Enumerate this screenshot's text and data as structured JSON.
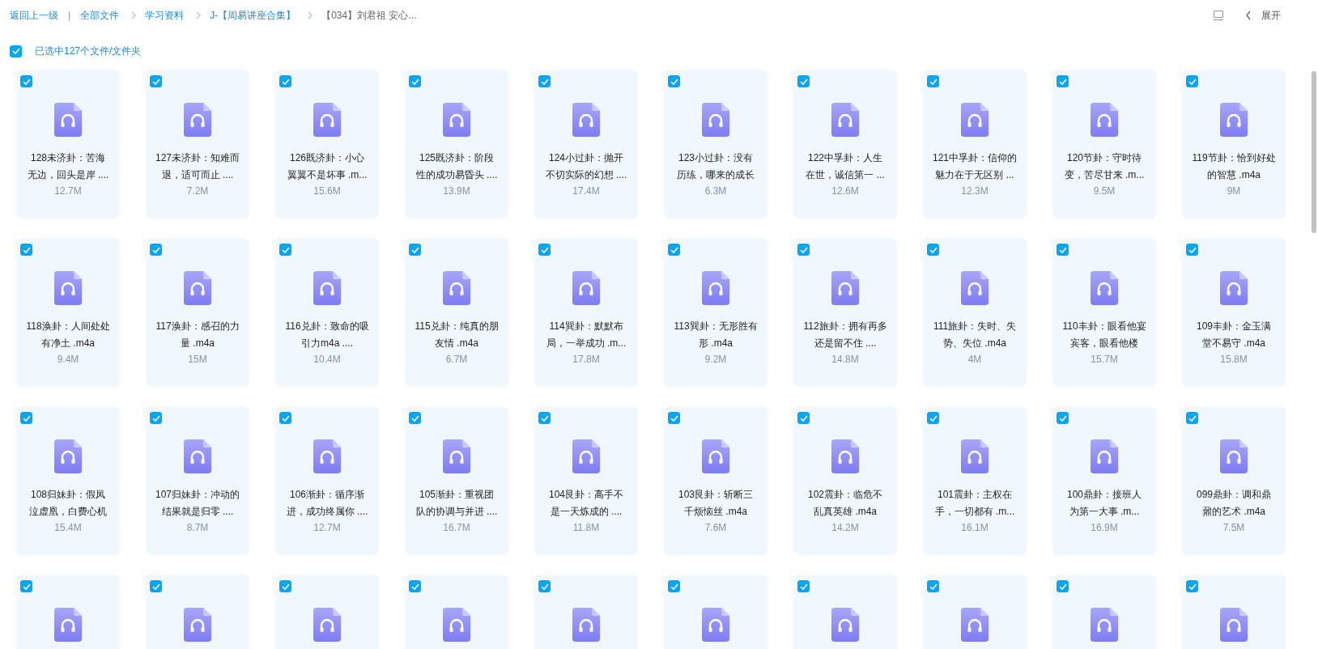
{
  "breadcrumb": {
    "back": "返回上一级",
    "separator": "|",
    "items": [
      {
        "label": "全部文件",
        "current": false
      },
      {
        "label": "学习资料",
        "current": false
      },
      {
        "label": "J-【周易讲座合集】",
        "current": false
      },
      {
        "label": "【034】刘君祖 安心...",
        "current": true
      }
    ]
  },
  "toolbar": {
    "expand": "展开"
  },
  "selection": {
    "checked": true,
    "label": "已选中127个文件/文件夹"
  },
  "files": [
    {
      "name_lines": [
        "128未济卦：苦海",
        "无边，回头是岸 ...."
      ],
      "size": "12.7M",
      "selected": true
    },
    {
      "name_lines": [
        "127未济卦：知难而",
        "退，适可而止 ...."
      ],
      "size": "7.2M",
      "selected": true
    },
    {
      "name_lines": [
        "126既济卦：小心",
        "翼翼不是坏事 .m..."
      ],
      "size": "15.6M",
      "selected": true
    },
    {
      "name_lines": [
        "125既济卦：阶段",
        "性的成功易昏头 ...."
      ],
      "size": "13.9M",
      "selected": true
    },
    {
      "name_lines": [
        "124小过卦：抛开",
        "不切实际的幻想 ...."
      ],
      "size": "17.4M",
      "selected": true
    },
    {
      "name_lines": [
        "123小过卦：没有",
        "历练，哪来的成长"
      ],
      "size": "6.3M",
      "selected": true
    },
    {
      "name_lines": [
        "122中孚卦：人生",
        "在世，诚信第一 ..."
      ],
      "size": "12.6M",
      "selected": true
    },
    {
      "name_lines": [
        "121中孚卦：信仰的",
        "魅力在于无区别 ..."
      ],
      "size": "12.3M",
      "selected": true
    },
    {
      "name_lines": [
        "120节卦：守时待",
        "变，苦尽甘来 .m..."
      ],
      "size": "9.5M",
      "selected": true
    },
    {
      "name_lines": [
        "119节卦：恰到好处",
        "的智慧 .m4a"
      ],
      "size": "9M",
      "selected": true
    },
    {
      "name_lines": [
        "118涣卦：人间处处",
        "有净土 .m4a"
      ],
      "size": "9.4M",
      "selected": true
    },
    {
      "name_lines": [
        "117涣卦：感召的力",
        "量 .m4a"
      ],
      "size": "15M",
      "selected": true
    },
    {
      "name_lines": [
        "116兑卦：致命的吸",
        "引力m4a ...."
      ],
      "size": "10.4M",
      "selected": true
    },
    {
      "name_lines": [
        "115兑卦：纯真的朋",
        "友情 .m4a"
      ],
      "size": "6.7M",
      "selected": true
    },
    {
      "name_lines": [
        "114巽卦：默默布",
        "局，一举成功 .m..."
      ],
      "size": "17.8M",
      "selected": true
    },
    {
      "name_lines": [
        "113巽卦：无形胜有",
        "形 .m4a"
      ],
      "size": "9.2M",
      "selected": true
    },
    {
      "name_lines": [
        "112旅卦：拥有再多",
        "还是留不住 ...."
      ],
      "size": "14.8M",
      "selected": true
    },
    {
      "name_lines": [
        "111旅卦：失时、失",
        "势、失位 .m4a"
      ],
      "size": "4M",
      "selected": true
    },
    {
      "name_lines": [
        "110丰卦：眼看他宴",
        "宾客，眼看他楼"
      ],
      "size": "15.7M",
      "selected": true
    },
    {
      "name_lines": [
        "109丰卦：金玉满",
        "堂不易守 .m4a"
      ],
      "size": "15.8M",
      "selected": true
    },
    {
      "name_lines": [
        "108归妹卦：假凤",
        "泣虚凰，白费心机"
      ],
      "size": "15.4M",
      "selected": true
    },
    {
      "name_lines": [
        "107归妹卦：冲动的",
        "结果就是归零 ...."
      ],
      "size": "8.7M",
      "selected": true
    },
    {
      "name_lines": [
        "106渐卦：循序渐",
        "进，成功终属你 ...."
      ],
      "size": "12.7M",
      "selected": true
    },
    {
      "name_lines": [
        "105渐卦：重视团",
        "队的协调与并进 ...."
      ],
      "size": "16.7M",
      "selected": true
    },
    {
      "name_lines": [
        "104艮卦：高手不",
        "是一天炼成的 ...."
      ],
      "size": "11.8M",
      "selected": true
    },
    {
      "name_lines": [
        "103艮卦：斩断三",
        "千烦恼丝 .m4a"
      ],
      "size": "7.6M",
      "selected": true
    },
    {
      "name_lines": [
        "102震卦：临危不",
        "乱真英雄 .m4a"
      ],
      "size": "14.2M",
      "selected": true
    },
    {
      "name_lines": [
        "101震卦：主权在",
        "手，一切都有 .m..."
      ],
      "size": "16.1M",
      "selected": true
    },
    {
      "name_lines": [
        "100鼎卦：接班人",
        "为第一大事 .m..."
      ],
      "size": "16.9M",
      "selected": true
    },
    {
      "name_lines": [
        "099鼎卦：调和鼎",
        "鼐的艺术 .m4a"
      ],
      "size": "7.5M",
      "selected": true
    },
    {
      "selected": true
    },
    {
      "selected": true
    },
    {
      "selected": true
    },
    {
      "selected": true
    },
    {
      "selected": true
    },
    {
      "selected": true
    },
    {
      "selected": true
    },
    {
      "selected": true
    },
    {
      "selected": true
    },
    {
      "selected": true
    }
  ]
}
